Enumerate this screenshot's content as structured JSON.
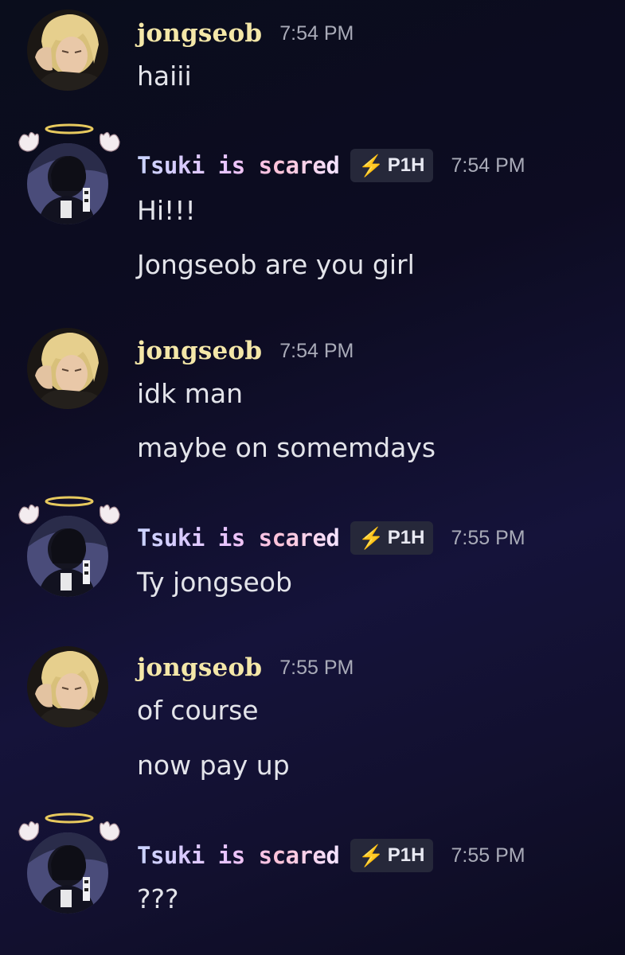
{
  "messages": [
    {
      "author": "jongseob",
      "author_type": "jongseob",
      "time": "7:54 PM",
      "lines": [
        "haiii"
      ]
    },
    {
      "author": "Tsuki is scared",
      "author_type": "tsuki",
      "tag": "P1H",
      "tag_icon": "lightning-icon",
      "time": "7:54 PM",
      "lines": [
        "Hi!!!",
        "Jongseob are you girl"
      ]
    },
    {
      "author": "jongseob",
      "author_type": "jongseob",
      "time": "7:54 PM",
      "lines": [
        "idk man",
        "maybe on somemdays"
      ]
    },
    {
      "author": "Tsuki is scared",
      "author_type": "tsuki",
      "tag": "P1H",
      "tag_icon": "lightning-icon",
      "time": "7:55 PM",
      "lines": [
        "Ty jongseob"
      ]
    },
    {
      "author": "jongseob",
      "author_type": "jongseob",
      "time": "7:55 PM",
      "lines": [
        "of course",
        "now pay up"
      ]
    },
    {
      "author": "Tsuki is scared",
      "author_type": "tsuki",
      "tag": "P1H",
      "tag_icon": "lightning-icon",
      "time": "7:55 PM",
      "lines": [
        "???"
      ]
    }
  ],
  "colors": {
    "jongseob_name": "#f4e7a8",
    "timestamp": "#a9abb8",
    "message_text": "#e3e4ea",
    "tag_bg": "#26283a"
  }
}
